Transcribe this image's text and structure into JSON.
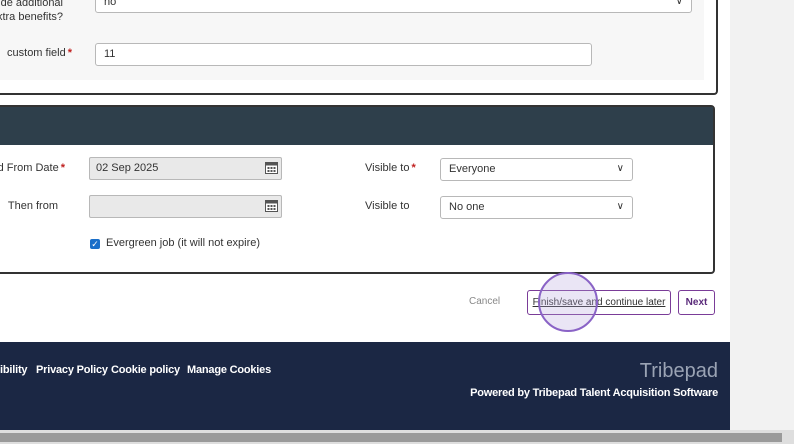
{
  "top_form": {
    "benefits_label_line1": "de additional",
    "benefits_label_line2": "xtra benefits?",
    "benefits_value": "no",
    "custom_field_label": " custom field",
    "custom_field_value": "11"
  },
  "posting": {
    "from_date_label": "d From Date",
    "from_date_value": "02 Sep 2025",
    "then_from_label": "Then from",
    "then_from_value": "",
    "visible_to_label_1": "Visible to",
    "visible_to_value_1": "Everyone",
    "visible_to_label_2": "Visible to",
    "visible_to_value_2": "No one",
    "evergreen_label": "Evergreen job (it will not expire)",
    "evergreen_checked": true
  },
  "actions": {
    "cancel": "Cancel",
    "finish_save": "Finish/save and continue later",
    "next": "Next"
  },
  "footer": {
    "links": [
      "ibility",
      "Privacy Policy",
      "Cookie policy",
      "Manage Cookies"
    ],
    "brand": "Tribepad",
    "powered_by": "Powered by Tribepad Talent Acquisition Software"
  },
  "colors": {
    "footer_bg": "#1b2744",
    "section_header_bg": "#2e3f4b",
    "button_border": "#7a3c98",
    "required": "#c0201f"
  }
}
